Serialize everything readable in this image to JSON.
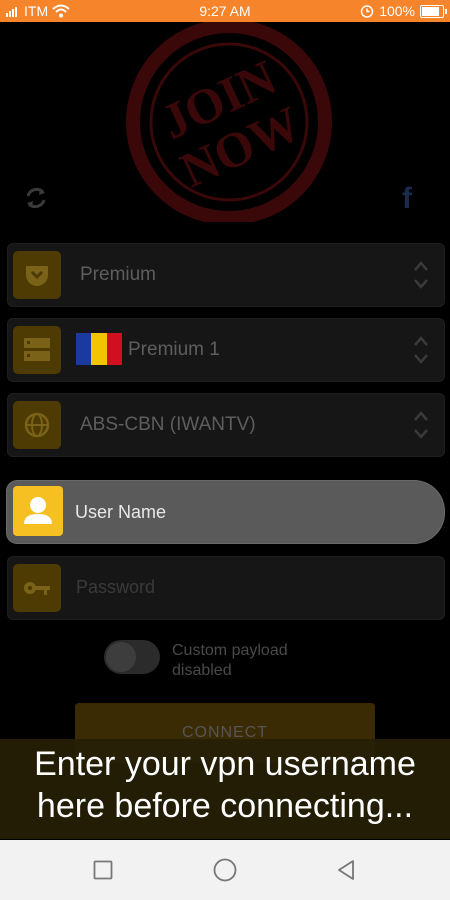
{
  "status_bar": {
    "carrier": "ITM",
    "time": "9:27 AM",
    "battery": "100%"
  },
  "stamp": {
    "text_line1": "JOIN",
    "text_line2": "NOW"
  },
  "selectors": [
    {
      "label": "Premium",
      "icon": "pocket-icon"
    },
    {
      "label": "Premium 1",
      "icon": "server-icon",
      "flag_colors": [
        "#1b3aa0",
        "#f2c500",
        "#d01020"
      ]
    },
    {
      "label": "ABS-CBN (IWANTV)",
      "icon": "globe-icon"
    }
  ],
  "username": {
    "placeholder": "User Name"
  },
  "password": {
    "placeholder": "Password"
  },
  "payload": {
    "line1": "Custom payload",
    "line2": "disabled"
  },
  "connect_label": "CONNECT",
  "caption": {
    "line1": "Enter your vpn username",
    "line2": "here before connecting..."
  },
  "colors": {
    "status_bar": "#f5842a",
    "accent": "#f6bf22",
    "stamp": "#3a0808"
  }
}
